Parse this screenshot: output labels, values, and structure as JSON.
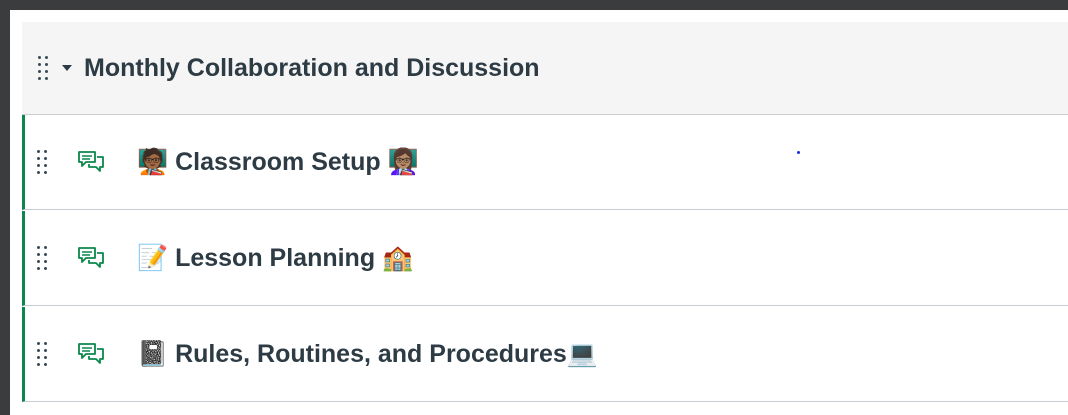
{
  "module": {
    "title": "Monthly Collaboration and Discussion"
  },
  "items": [
    {
      "type_icon": "discussion-icon",
      "title": "🧑🏾‍🏫 Classroom Setup 👩🏽‍🏫"
    },
    {
      "type_icon": "discussion-icon",
      "title": "📝 Lesson Planning 🏫"
    },
    {
      "type_icon": "discussion-icon",
      "title": "📓 Rules, Routines, and Procedures💻"
    }
  ],
  "colors": {
    "accent_border": "#0b874b",
    "icon_green": "#0b874b",
    "text": "#2d3b45",
    "header_bg": "#f5f5f5",
    "outer_bg": "#3b3c3e"
  }
}
